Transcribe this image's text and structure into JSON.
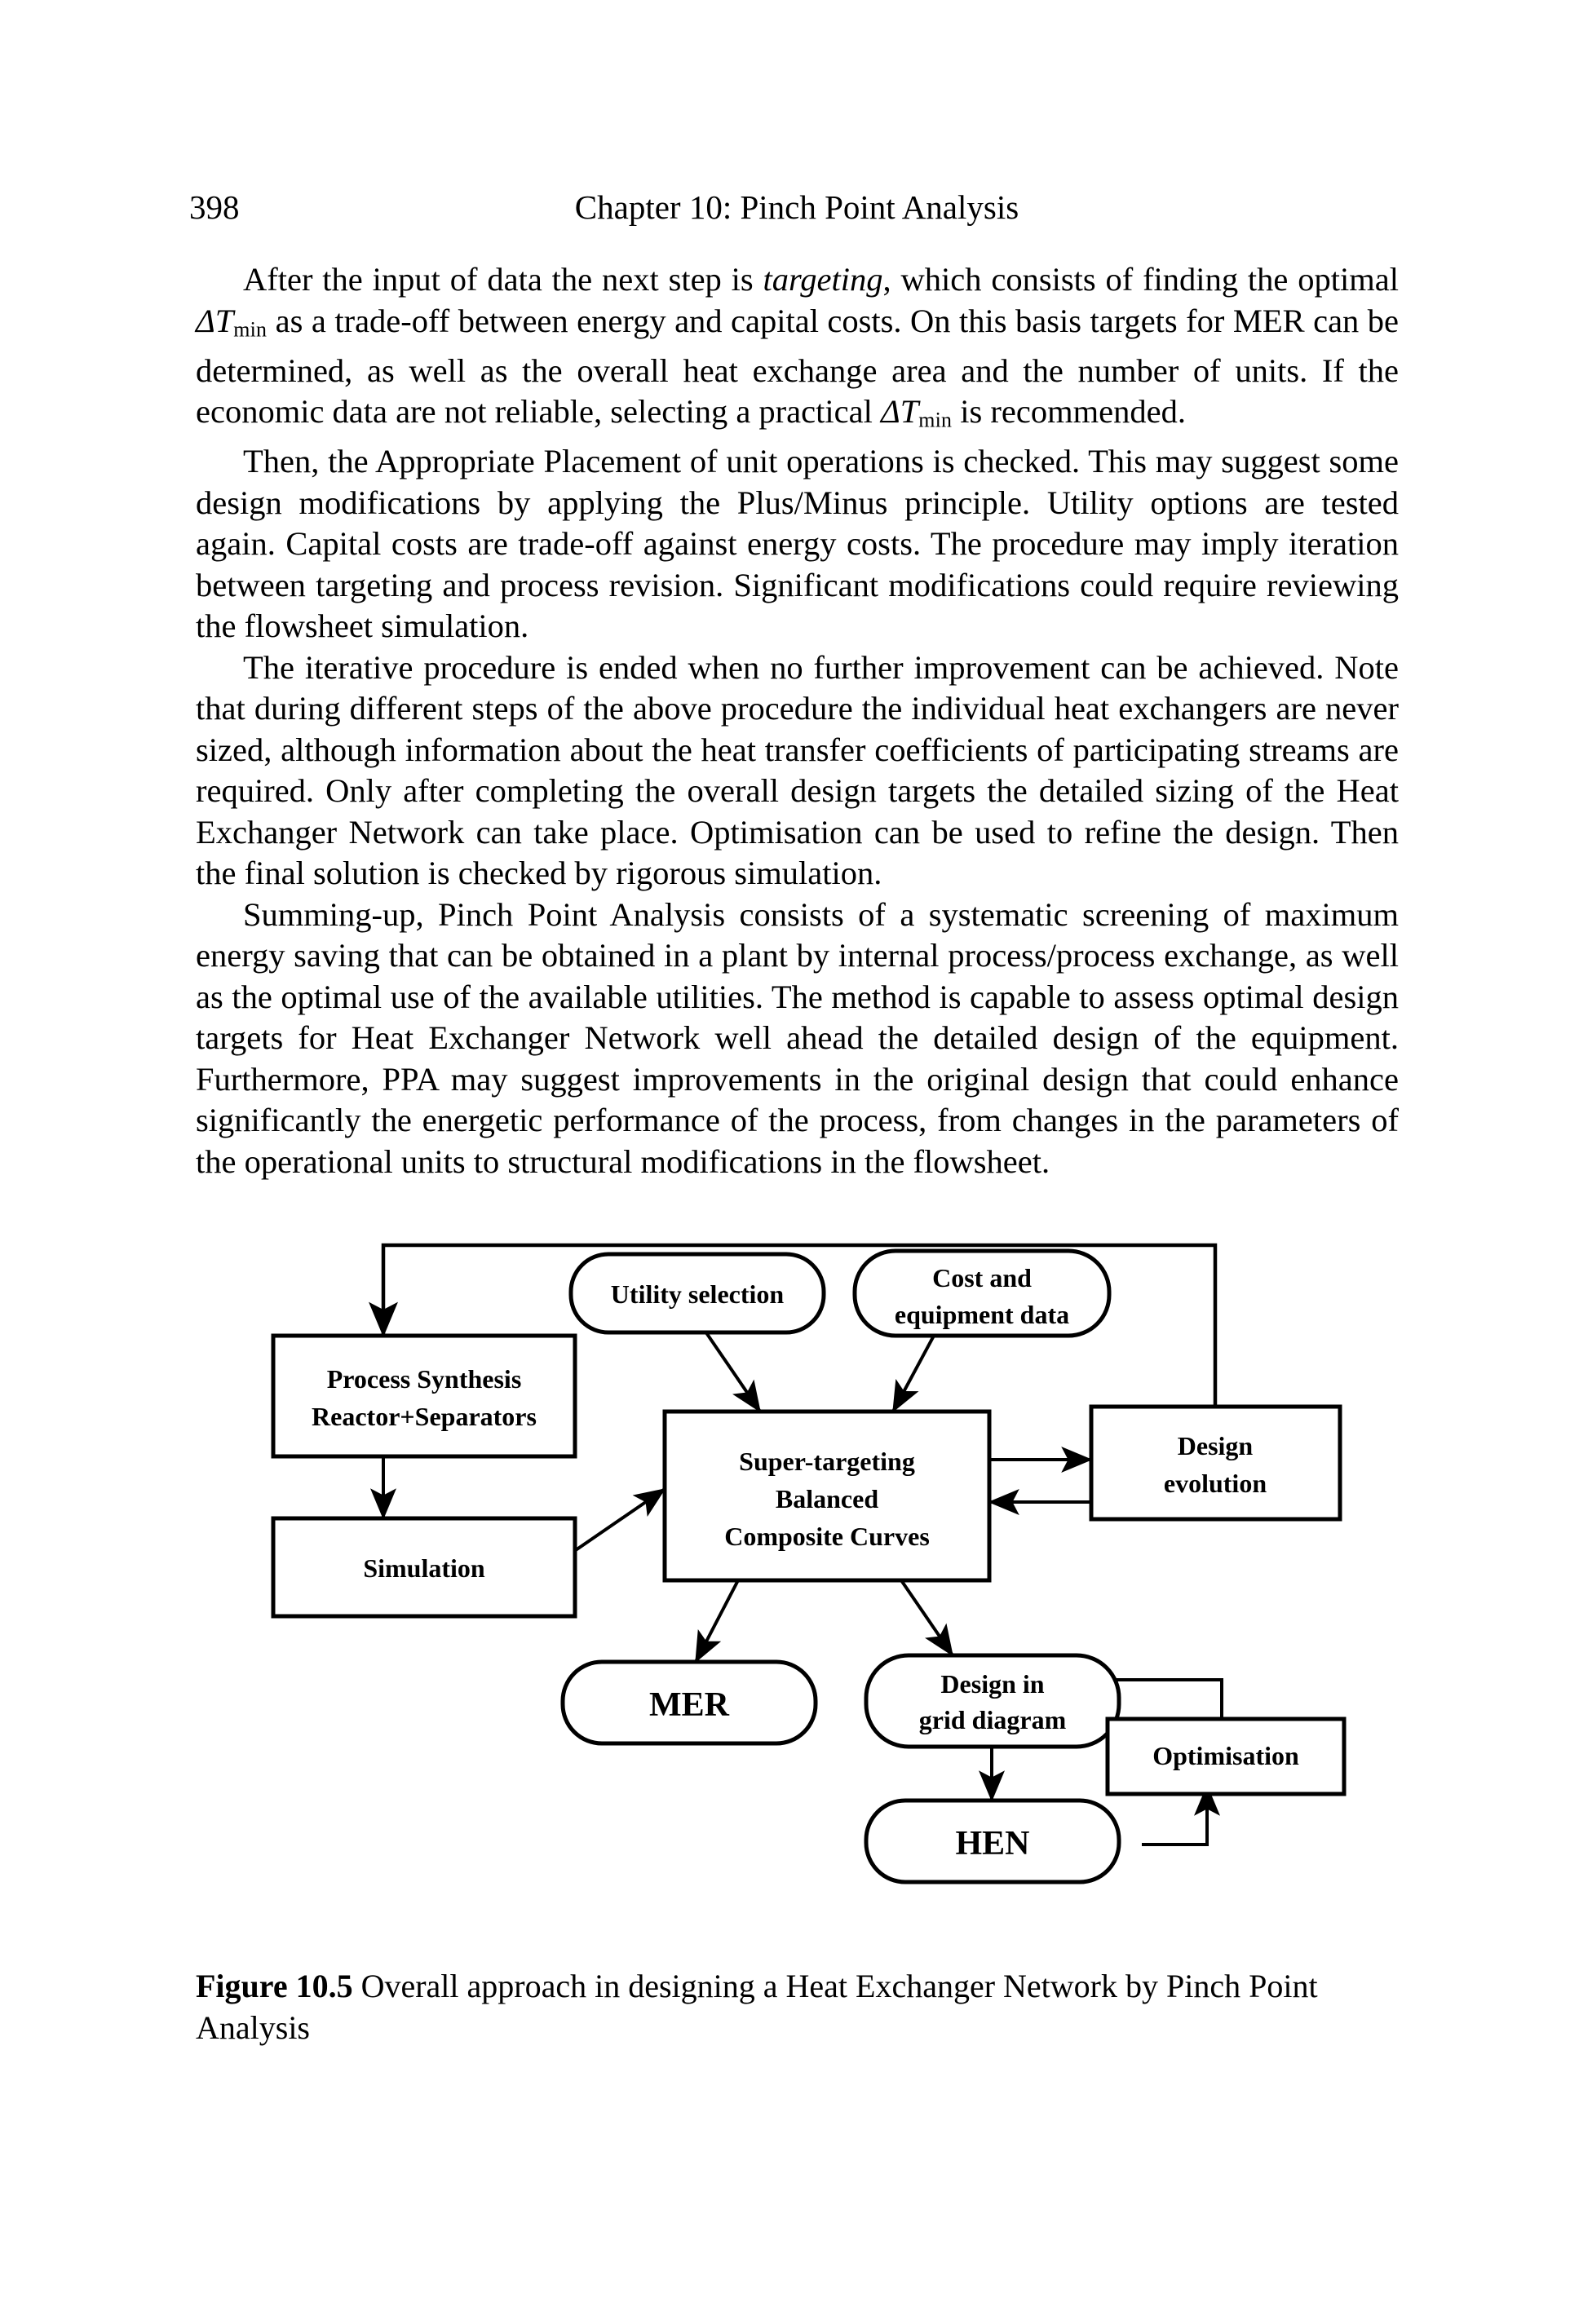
{
  "page": {
    "folio": "398",
    "running_head": "Chapter 10: Pinch Point Analysis"
  },
  "body": {
    "paragraph_1_a": "After the input of data the next step is ",
    "paragraph_1_italic": "targeting",
    "paragraph_1_b": ", which consists of finding the optimal ",
    "paragraph_1_sym1": "ΔT",
    "paragraph_1_sub1": "min",
    "paragraph_1_c": " as a trade-off between energy and capital costs. On this basis targets for MER can be determined, as well as the overall heat exchange area and the number of units.  If the economic data are not reliable, selecting a practical ",
    "paragraph_1_sym2": "ΔT",
    "paragraph_1_sub2": "min",
    "paragraph_1_d": " is recommended.",
    "paragraph_2": "Then, the Appropriate Placement of unit operations is checked. This may suggest some design modifications by applying the Plus/Minus principle. Utility options are tested again. Capital costs are trade-off against energy costs. The procedure may imply iteration between targeting and process revision. Significant modifications could require reviewing the flowsheet simulation.",
    "paragraph_3": "The iterative procedure is ended when no further improvement can be achieved. Note that during different steps of the above procedure the individual heat exchangers are never sized, although information about the heat transfer coefficients of participating streams are required. Only after completing the overall design targets the detailed sizing of the Heat Exchanger Network can take place. Optimisation can be used to refine the design. Then the final solution is checked by rigorous simulation.",
    "paragraph_4": "Summing-up, Pinch Point Analysis consists of a systematic screening of maximum energy saving that can be obtained in a plant by internal process/process exchange, as well as the optimal use of the available utilities. The method is capable to assess optimal design targets for Heat Exchanger Network well ahead the detailed design of the equipment. Furthermore, PPA may suggest improvements in the original design that could enhance significantly the energetic performance of the process, from changes in the parameters of the operational units to structural modifications in the flowsheet."
  },
  "figure": {
    "caption_label": "Figure 10.5",
    "caption_text": " Overall approach in designing a Heat Exchanger Network by Pinch Point Analysis",
    "nodes": {
      "process_synthesis_line1": "Process Synthesis",
      "process_synthesis_line2": "Reactor+Separators",
      "simulation": "Simulation",
      "utility_selection": "Utility selection",
      "cost_data_line1": "Cost and",
      "cost_data_line2": "equipment data",
      "supertargeting_line1": "Super-targeting",
      "supertargeting_line2": "Balanced",
      "supertargeting_line3": "Composite Curves",
      "design_evolution_line1": "Design",
      "design_evolution_line2": "evolution",
      "mer": "MER",
      "design_grid_line1": "Design in",
      "design_grid_line2": "grid diagram",
      "hen": "HEN",
      "optimisation": "Optimisation"
    }
  },
  "colors": {
    "ink": "#000000",
    "paper": "#ffffff"
  }
}
